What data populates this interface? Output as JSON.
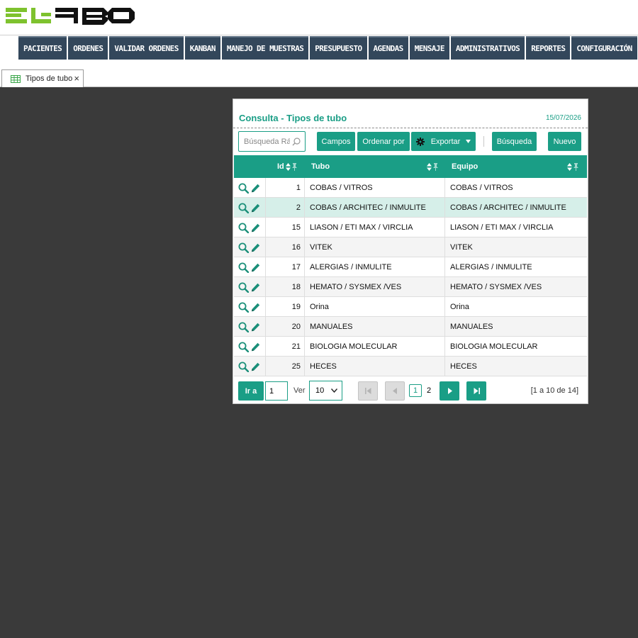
{
  "nav": {
    "items": [
      "PACIENTES",
      "ORDENES",
      "VALIDAR ORDENES",
      "KANBAN",
      "MANEJO DE MUESTRAS",
      "PRESUPUESTO",
      "AGENDAS",
      "MENSAJE",
      "ADMINISTRATIVOS",
      "REPORTES",
      "CONFIGURACIÓN"
    ]
  },
  "tab": {
    "label": "Tipos de tubo",
    "close": "×"
  },
  "panel": {
    "title": "Consulta - Tipos de tubo",
    "date": "15/07/2026"
  },
  "toolbar": {
    "search_placeholder": "Búsqueda Rápida",
    "campos": "Campos",
    "ordenar": "Ordenar por",
    "exportar": "Exportar",
    "busqueda": "Búsqueda",
    "nuevo": "Nuevo"
  },
  "grid": {
    "headers": {
      "id": "Id",
      "tubo": "Tubo",
      "equipo": "Equipo"
    },
    "rows": [
      {
        "id": "1",
        "tubo": "COBAS / VITROS",
        "equipo": "COBAS / VITROS"
      },
      {
        "id": "2",
        "tubo": "COBAS / ARCHITEC / INMULITE",
        "equipo": "COBAS / ARCHITEC / INMULITE"
      },
      {
        "id": "15",
        "tubo": "LIASON / ETI MAX / VIRCLIA",
        "equipo": "LIASON / ETI MAX / VIRCLIA"
      },
      {
        "id": "16",
        "tubo": "VITEK",
        "equipo": "VITEK"
      },
      {
        "id": "17",
        "tubo": "ALERGIAS / INMULITE",
        "equipo": "ALERGIAS / INMULITE"
      },
      {
        "id": "18",
        "tubo": "HEMATO / SYSMEX /VES",
        "equipo": "HEMATO / SYSMEX /VES"
      },
      {
        "id": "19",
        "tubo": "Orina",
        "equipo": "Orina"
      },
      {
        "id": "20",
        "tubo": "MANUALES",
        "equipo": "MANUALES"
      },
      {
        "id": "21",
        "tubo": "BIOLOGIA MOLECULAR",
        "equipo": "BIOLOGIA MOLECULAR"
      },
      {
        "id": "25",
        "tubo": "HECES",
        "equipo": "HECES"
      }
    ]
  },
  "pager": {
    "ir_a": "Ir a",
    "page_value": "1",
    "ver": "Ver",
    "per_page": "10",
    "pages": [
      "1",
      "2"
    ],
    "range": "[1 a 10 de 14]"
  },
  "colors": {
    "accent": "#1a9e86",
    "nav": "#33475b",
    "background": "#3a3a3a"
  }
}
